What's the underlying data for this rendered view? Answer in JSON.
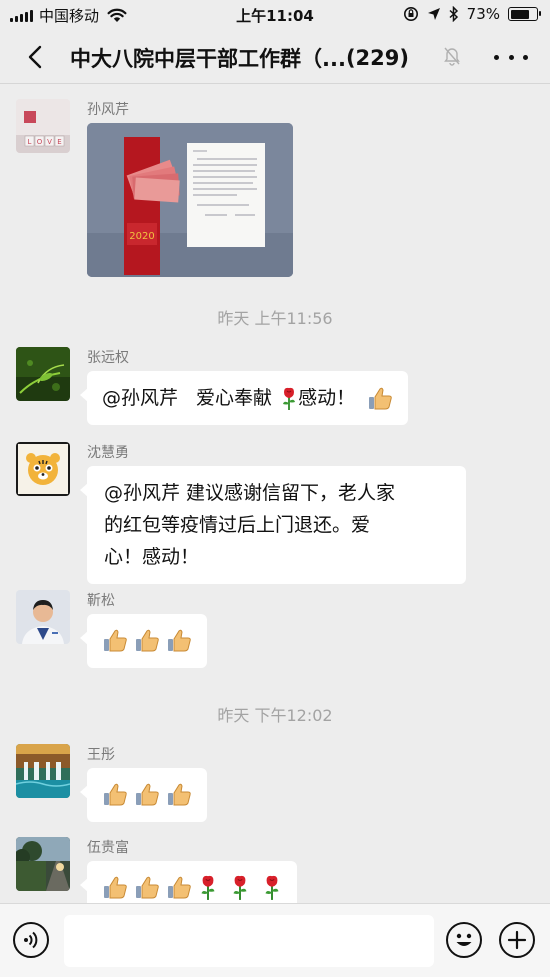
{
  "status_bar": {
    "carrier": "中国移动",
    "time": "上午11:04",
    "battery_text": "73%",
    "battery_level": 0.73
  },
  "nav": {
    "title": "中大八院中层干部工作群（...",
    "member_count": "(229)"
  },
  "messages": [
    {
      "sender": "孙风芹",
      "type": "image",
      "avatar_icon": "love-blocks-avatar"
    },
    {
      "type": "timestamp",
      "text": "昨天 上午11:56"
    },
    {
      "sender": "张远权",
      "type": "text",
      "mention": "@孙风芹",
      "text": "爱心奉献",
      "text2": "感动！",
      "emojis": [
        "rose",
        "thumbs-up"
      ]
    },
    {
      "sender": "沈慧勇",
      "type": "text",
      "lines": [
        "@孙风芹 建议感谢信留下，老人家",
        "的红包等疫情过后上门退还。爱",
        "心！感动！"
      ]
    },
    {
      "sender": "靳松",
      "type": "emoji",
      "emojis": [
        "thumbs-up",
        "thumbs-up",
        "thumbs-up"
      ]
    },
    {
      "type": "timestamp",
      "text": "昨天 下午12:02"
    },
    {
      "sender": "王彤",
      "type": "emoji",
      "emojis": [
        "thumbs-up",
        "thumbs-up",
        "thumbs-up"
      ]
    },
    {
      "sender": "伍贵富",
      "type": "emoji",
      "emojis": [
        "thumbs-up",
        "thumbs-up",
        "thumbs-up",
        "rose",
        "rose",
        "rose"
      ]
    }
  ],
  "input_bar": {
    "placeholder": ""
  },
  "colors": {
    "background": "#ededed",
    "bubble": "#ffffff",
    "timestamp": "#a3a3a3",
    "sender": "#7a7a7a"
  }
}
